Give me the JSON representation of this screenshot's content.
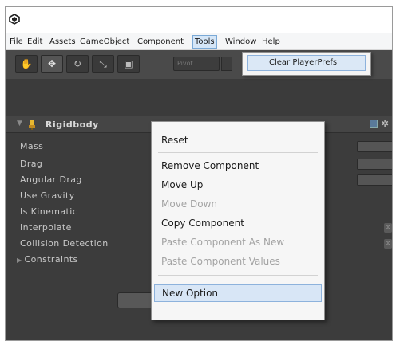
{
  "menubar": {
    "items": [
      {
        "label": "File"
      },
      {
        "label": "Edit"
      },
      {
        "label": "Assets"
      },
      {
        "label": "GameObject"
      },
      {
        "label": "Component"
      },
      {
        "label": "Tools"
      },
      {
        "label": "Window"
      },
      {
        "label": "Help"
      }
    ]
  },
  "toolbar": {
    "tools": [
      {
        "icon": "hand-icon",
        "glyph": "✋"
      },
      {
        "icon": "move-icon",
        "glyph": "✥"
      },
      {
        "icon": "rotate-icon",
        "glyph": "↻"
      },
      {
        "icon": "scale-icon",
        "glyph": "⤡"
      },
      {
        "icon": "rect-icon",
        "glyph": "▣"
      }
    ],
    "pivot_label": "Pivot"
  },
  "tools_dropdown": {
    "items": [
      {
        "label": "Clear PlayerPrefs"
      }
    ]
  },
  "rigidbody": {
    "title": "Rigidbody",
    "properties": [
      {
        "label": "Mass"
      },
      {
        "label": "Drag"
      },
      {
        "label": "Angular Drag"
      },
      {
        "label": "Use Gravity"
      },
      {
        "label": "Is Kinematic"
      },
      {
        "label": "Interpolate"
      },
      {
        "label": "Collision Detection"
      },
      {
        "label": "Constraints"
      }
    ]
  },
  "context_menu": {
    "items": [
      {
        "label": "Reset",
        "enabled": true
      },
      {
        "label": "Remove Component",
        "enabled": true
      },
      {
        "label": "Move Up",
        "enabled": true
      },
      {
        "label": "Move Down",
        "enabled": false
      },
      {
        "label": "Copy Component",
        "enabled": true
      },
      {
        "label": "Paste Component As New",
        "enabled": false
      },
      {
        "label": "Paste Component Values",
        "enabled": false
      },
      {
        "label": "New Option",
        "enabled": true
      }
    ]
  },
  "colors": {
    "inspector_bg": "#3c3c3c",
    "menu_highlight": "#d8e6f6",
    "menu_highlight_border": "#8db2dc",
    "disabled_text": "#a3a3a3"
  }
}
